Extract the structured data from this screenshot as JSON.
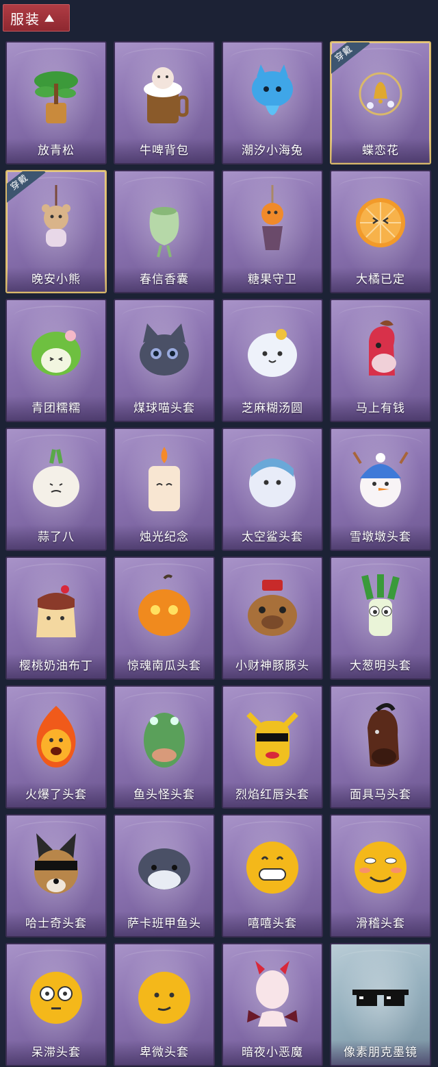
{
  "header": {
    "title": "服装",
    "chevron": "chevron-up-icon"
  },
  "badge_label": "穿戴",
  "items": [
    {
      "label": "放青松",
      "icon": "bonsai-pine-icon",
      "worn": false
    },
    {
      "label": "牛啤背包",
      "icon": "beer-mug-cow-backpack-icon",
      "worn": false
    },
    {
      "label": "潮汐小海兔",
      "icon": "sea-bunny-icon",
      "worn": false
    },
    {
      "label": "蝶恋花",
      "icon": "butterfly-bell-ornament-icon",
      "worn": true
    },
    {
      "label": "晚安小熊",
      "icon": "bear-charm-icon",
      "worn": true
    },
    {
      "label": "春信香囊",
      "icon": "sachet-icon",
      "worn": false
    },
    {
      "label": "糖果守卫",
      "icon": "candy-guard-charm-icon",
      "worn": false
    },
    {
      "label": "大橘已定",
      "icon": "orange-slice-icon",
      "worn": false
    },
    {
      "label": "青团糯糯",
      "icon": "green-rice-ball-icon",
      "worn": false
    },
    {
      "label": "煤球喵头套",
      "icon": "black-cat-mask-icon",
      "worn": false
    },
    {
      "label": "芝麻糊汤圆",
      "icon": "rice-dumpling-icon",
      "worn": false
    },
    {
      "label": "马上有钱",
      "icon": "horse-head-icon",
      "worn": false
    },
    {
      "label": "蒜了八",
      "icon": "garlic-icon",
      "worn": false
    },
    {
      "label": "烛光纪念",
      "icon": "candle-icon",
      "worn": false
    },
    {
      "label": "太空鲨头套",
      "icon": "shark-mask-icon",
      "worn": false
    },
    {
      "label": "雪墩墩头套",
      "icon": "snowman-mask-icon",
      "worn": false
    },
    {
      "label": "樱桃奶油布丁",
      "icon": "pudding-icon",
      "worn": false
    },
    {
      "label": "惊魂南瓜头套",
      "icon": "pumpkin-mask-icon",
      "worn": false
    },
    {
      "label": "小财神豚豚头",
      "icon": "capybara-mask-icon",
      "worn": false
    },
    {
      "label": "大葱明头套",
      "icon": "scallion-mask-icon",
      "worn": false
    },
    {
      "label": "火爆了头套",
      "icon": "fire-mask-icon",
      "worn": false
    },
    {
      "label": "鱼头怪头套",
      "icon": "fish-head-mask-icon",
      "worn": false
    },
    {
      "label": "烈焰红唇头套",
      "icon": "yellow-mask-sunglasses-icon",
      "worn": false
    },
    {
      "label": "面具马头套",
      "icon": "horse-mask-icon",
      "worn": false
    },
    {
      "label": "哈士奇头套",
      "icon": "husky-mask-icon",
      "worn": false
    },
    {
      "label": "萨卡班甲鱼头",
      "icon": "fish-mask-icon",
      "worn": false
    },
    {
      "label": "嘻嘻头套",
      "icon": "grin-emoji-mask-icon",
      "worn": false
    },
    {
      "label": "滑稽头套",
      "icon": "funny-emoji-mask-icon",
      "worn": false
    },
    {
      "label": "呆滞头套",
      "icon": "dazed-emoji-mask-icon",
      "worn": false
    },
    {
      "label": "卑微头套",
      "icon": "humble-emoji-mask-icon",
      "worn": false
    },
    {
      "label": "暗夜小恶魔",
      "icon": "little-devil-mask-icon",
      "worn": false
    },
    {
      "label": "像素朋克墨镜",
      "icon": "pixel-sunglasses-icon",
      "worn": false,
      "special": true
    }
  ],
  "colors": {
    "background": "#1c2235",
    "card": "#8a72b0",
    "special_card": "#93aebc",
    "header_tab": "#a3343c",
    "worn_border": "#d9b86a"
  }
}
